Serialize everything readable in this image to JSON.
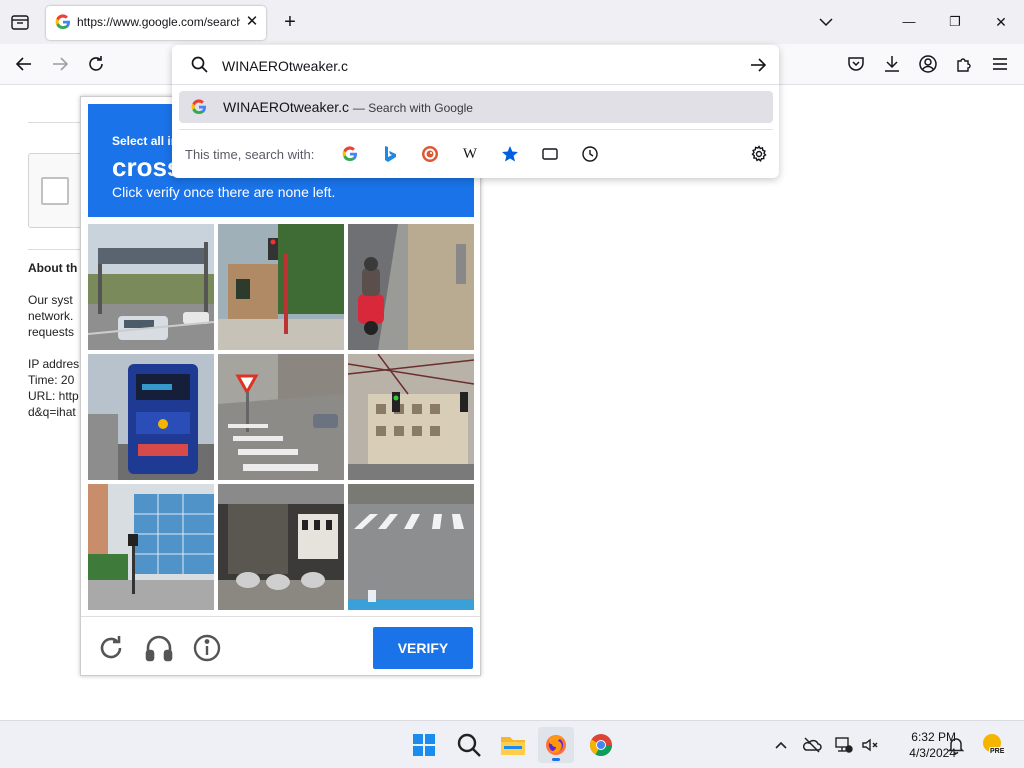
{
  "browser": {
    "tab": {
      "title": "https://www.google.com/search?q=WINAEROtweaker",
      "close": "✕"
    },
    "new_tab": "+",
    "window_controls": {
      "minimize": "—",
      "maximize": "❐",
      "close": "✕"
    }
  },
  "url_bar": {
    "value": "WINAEROtweaker.c",
    "suggestion": {
      "query": "WINAEROtweaker.c",
      "desc": "— Search with Google"
    },
    "this_time_label": "This time, search with:",
    "engines": [
      "google-icon",
      "bing-icon",
      "duckduckgo-icon",
      "wikipedia-icon",
      "bookmarks-icon",
      "tabs-icon",
      "history-icon"
    ],
    "wikipedia_glyph": "W"
  },
  "page": {
    "heading": "About th",
    "lines": [
      "Our syst",
      "network.",
      "requests"
    ],
    "details": [
      "IP addres",
      "Time: 20",
      "URL: http",
      "d&q=ihat"
    ]
  },
  "captcha": {
    "instruction_small": "Select all im",
    "target": "cross",
    "instruction_sub": "Click verify once there are none left.",
    "verify_label": "VERIFY",
    "tiles": [
      "highway-gantry",
      "traffic-light-street",
      "scooter-rider",
      "blue-bus",
      "yield-sign-crosswalk",
      "railway-station",
      "glass-building",
      "motorbikes-storefront",
      "crosswalk-road"
    ]
  },
  "taskbar": {
    "time": "6:32 PM",
    "date": "4/3/2024",
    "badge": "PRE"
  },
  "colors": {
    "accent": "#1a73e8",
    "tabstrip": "#f0f0f4",
    "taskbar": "#eef0f5"
  }
}
